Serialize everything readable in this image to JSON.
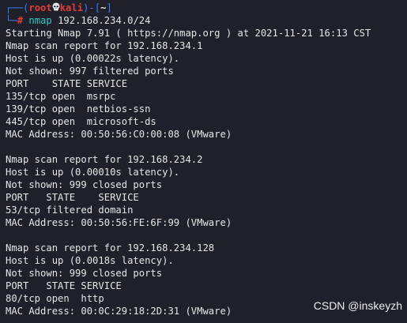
{
  "prompt": {
    "open": "┌──(",
    "user": "root",
    "skull_icon": "skull-icon",
    "host": "kali",
    "mid": ")-[",
    "dir": "~",
    "close": "]",
    "corner": "└─",
    "hash": "#",
    "command": "nmap",
    "args": " 192.168.234.0/24"
  },
  "output": [
    "Starting Nmap 7.91 ( https://nmap.org ) at 2021-11-21 16:13 CST",
    "Nmap scan report for 192.168.234.1",
    "Host is up (0.00022s latency).",
    "Not shown: 997 filtered ports",
    "PORT    STATE SERVICE",
    "135/tcp open  msrpc",
    "139/tcp open  netbios-ssn",
    "445/tcp open  microsoft-ds",
    "MAC Address: 00:50:56:C0:00:08 (VMware)",
    "",
    "Nmap scan report for 192.168.234.2",
    "Host is up (0.00010s latency).",
    "Not shown: 999 closed ports",
    "PORT   STATE    SERVICE",
    "53/tcp filtered domain",
    "MAC Address: 00:50:56:FE:6F:99 (VMware)",
    "",
    "Nmap scan report for 192.168.234.128",
    "Host is up (0.0018s latency).",
    "Not shown: 999 closed ports",
    "PORT   STATE SERVICE",
    "80/tcp open  http",
    "MAC Address: 00:0C:29:18:2D:31 (VMware)"
  ],
  "watermark": "CSDN @inskeyzh",
  "colors": {
    "background": "#1f2029",
    "prompt_frame": "#3c7cf4",
    "prompt_user": "#e23b3b",
    "command": "#38c6c6",
    "text": "#e6e6e6"
  }
}
